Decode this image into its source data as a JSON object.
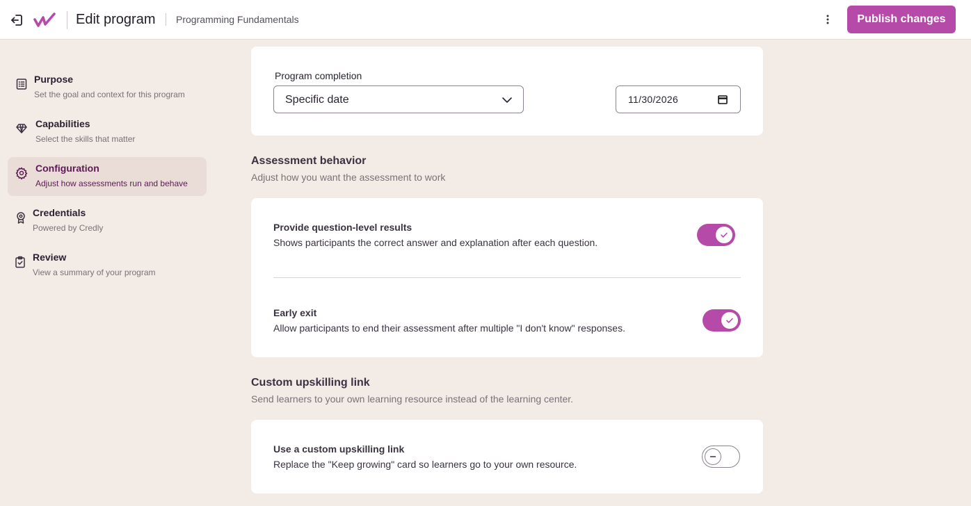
{
  "header": {
    "title": "Edit program",
    "subtitle": "Programming Fundamentals",
    "publish_label": "Publish changes",
    "brand_color": "#b64aa8",
    "icons": [
      "exit-icon",
      "brand-logo",
      "more-vertical-icon"
    ]
  },
  "sidebar": {
    "items": [
      {
        "title": "Purpose",
        "desc": "Set the goal and context for this program",
        "icon": "list-icon"
      },
      {
        "title": "Capabilities",
        "desc": "Select the skills that matter",
        "icon": "gem-icon"
      },
      {
        "title": "Configuration",
        "desc": "Adjust how assessments run and behave",
        "icon": "gear-icon",
        "active": true
      },
      {
        "title": "Credentials",
        "desc": "Powered by Credly",
        "icon": "award-icon"
      },
      {
        "title": "Review",
        "desc": "View a summary of your program",
        "icon": "clipboard-check-icon"
      }
    ]
  },
  "completion": {
    "label": "Program completion",
    "select_value": "Specific date",
    "date_value": "11/30/2026"
  },
  "assessment": {
    "title": "Assessment behavior",
    "desc": "Adjust how you want the assessment to work",
    "options": [
      {
        "title": "Provide question-level results",
        "desc": "Shows participants the correct answer and explanation after each question.",
        "enabled": true
      },
      {
        "title": "Early exit",
        "desc": "Allow participants to end their assessment after multiple \"I don't know\" responses.",
        "enabled": true
      }
    ]
  },
  "upskilling": {
    "title": "Custom upskilling link",
    "desc": "Send learners to your own learning resource instead of the learning center.",
    "option": {
      "title": "Use a custom upskilling link",
      "desc": "Replace the \"Keep growing\" card so learners go to your own resource.",
      "enabled": false
    }
  }
}
